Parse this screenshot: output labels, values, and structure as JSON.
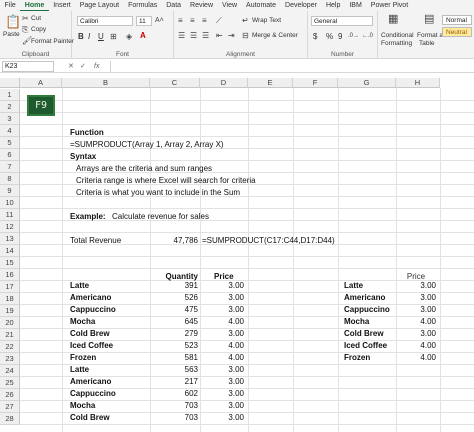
{
  "tabs": [
    "File",
    "Home",
    "Insert",
    "Page Layout",
    "Formulas",
    "Data",
    "Review",
    "View",
    "Automate",
    "Developer",
    "Help",
    "IBM",
    "Power Pivot"
  ],
  "active_tab": "Home",
  "ribbon": {
    "paste": "Paste",
    "cut": "Cut",
    "copy": "Copy",
    "format_painter": "Format Painter",
    "clipboard_label": "Clipboard",
    "font_name": "Calibri",
    "font_size": "11",
    "font_label": "Font",
    "bold": "B",
    "italic": "I",
    "underline": "U",
    "wrap_text": "Wrap Text",
    "merge_center": "Merge & Center",
    "alignment_label": "Alignment",
    "number_format": "General",
    "currency": "$",
    "percent": "%",
    "comma": "9",
    "number_label": "Number",
    "conditional": "Conditional",
    "formatting": "Formatting",
    "format_as": "Format as",
    "table": "Table",
    "style_normal": "Normal",
    "style_neutral": "Neutral"
  },
  "formula_bar": {
    "name_box": "K23",
    "fx": "fx",
    "value": ""
  },
  "columns": [
    "A",
    "B",
    "C",
    "D",
    "E",
    "F",
    "G",
    "H"
  ],
  "rows": [
    "1",
    "2",
    "3",
    "4",
    "5",
    "6",
    "7",
    "8",
    "9",
    "10",
    "11",
    "12",
    "13",
    "14",
    "15",
    "16",
    "17",
    "18",
    "19",
    "20",
    "21",
    "22",
    "23",
    "24",
    "25",
    "26",
    "27",
    "28"
  ],
  "logo_text": "F9",
  "notes": {
    "function_heading": "Function",
    "syntax_line": "=SUMPRODUCT(Array 1, Array 2, Array X)",
    "syntax_heading": "Syntax",
    "line1": "Arrays are the criteria and sum ranges",
    "line2": "Criteria range is where Excel will search for criteria",
    "line3": "Criteria is what you want to include in the Sum",
    "example_bold": "Example:",
    "example_text": "Calculate revenue for sales",
    "total_label": "Total Revenue",
    "total_value": "47,786",
    "total_formula": "=SUMPRODUCT(C17:C44,D17:D44)"
  },
  "headers": {
    "quantity": "Quantity",
    "price": "Price",
    "price_lookup": "Price"
  },
  "sales": [
    {
      "item": "Latte",
      "qty": "391",
      "price": "3.00"
    },
    {
      "item": "Americano",
      "qty": "526",
      "price": "3.00"
    },
    {
      "item": "Cappuccino",
      "qty": "475",
      "price": "3.00"
    },
    {
      "item": "Mocha",
      "qty": "645",
      "price": "4.00"
    },
    {
      "item": "Cold Brew",
      "qty": "279",
      "price": "3.00"
    },
    {
      "item": "Iced Coffee",
      "qty": "523",
      "price": "4.00"
    },
    {
      "item": "Frozen",
      "qty": "581",
      "price": "4.00"
    },
    {
      "item": "Latte",
      "qty": "563",
      "price": "3.00"
    },
    {
      "item": "Americano",
      "qty": "217",
      "price": "3.00"
    },
    {
      "item": "Cappuccino",
      "qty": "602",
      "price": "3.00"
    },
    {
      "item": "Mocha",
      "qty": "703",
      "price": "3.00"
    },
    {
      "item": "Cold Brew",
      "qty": "703",
      "price": "3.00"
    }
  ],
  "price_list": [
    {
      "item": "Latte",
      "price": "3.00"
    },
    {
      "item": "Americano",
      "price": "3.00"
    },
    {
      "item": "Cappuccino",
      "price": "3.00"
    },
    {
      "item": "Mocha",
      "price": "4.00"
    },
    {
      "item": "Cold Brew",
      "price": "3.00"
    },
    {
      "item": "Iced Coffee",
      "price": "4.00"
    },
    {
      "item": "Frozen",
      "price": "4.00"
    }
  ],
  "colors": {
    "accent": "#1e7145",
    "logo_bg": "#1e5a2d"
  }
}
